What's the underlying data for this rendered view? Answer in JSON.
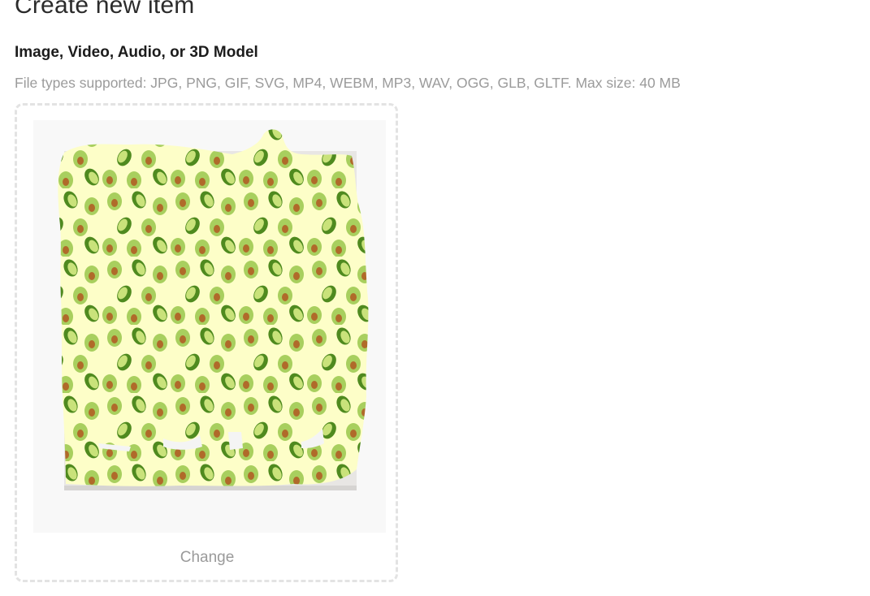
{
  "page": {
    "title": "Create new item"
  },
  "upload": {
    "label": "Image, Video, Audio, or 3D Model",
    "hint": "File types supported: JPG, PNG, GIF, SVG, MP4, WEBM, MP3, WAV, OGG, GLB, GLTF. Max size: 40 MB",
    "change_label": "Change",
    "preview": {
      "description_icon": "avocado-pattern-image",
      "colors": {
        "background": "#fdfec8",
        "avocado_outer": "#a8cf5e",
        "avocado_skin": "#4f8a1f",
        "avocado_flesh": "#c9e27a",
        "avocado_pit": "#b06a2a"
      }
    }
  }
}
